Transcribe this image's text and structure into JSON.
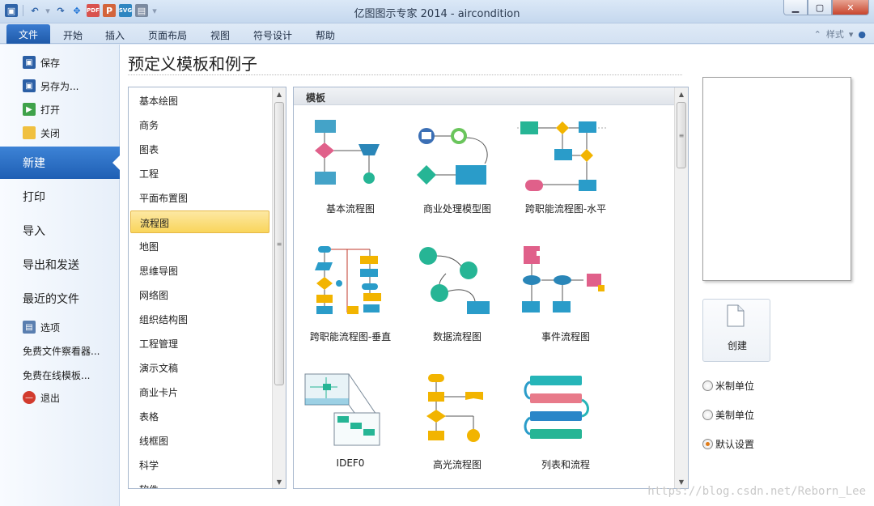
{
  "window": {
    "title": "亿图图示专家 2014 - aircondition",
    "controls": [
      "minimize-icon",
      "maximize-icon",
      "close-icon"
    ]
  },
  "quick_access": [
    "save-icon",
    "undo-icon",
    "redo-icon",
    "move-icon",
    "pdf-icon",
    "ppt-icon",
    "svg-icon",
    "print-icon"
  ],
  "ribbon": {
    "file_tab": "文件",
    "tabs": [
      "开始",
      "插入",
      "页面布局",
      "视图",
      "符号设计",
      "帮助"
    ],
    "right_text": "样式"
  },
  "backstage_nav": {
    "top_items": [
      {
        "label": "保存",
        "icon": "save-icon"
      },
      {
        "label": "另存为...",
        "icon": "save-as-icon"
      },
      {
        "label": "打开",
        "icon": "open-icon"
      },
      {
        "label": "关闭",
        "icon": "close-folder-icon"
      }
    ],
    "big_items": [
      "新建",
      "打印",
      "导入",
      "导出和发送",
      "最近的文件"
    ],
    "active": "新建",
    "bottom_items": [
      {
        "label": "选项",
        "icon": "options-icon"
      },
      {
        "label": "免费文件察看器...",
        "icon": ""
      },
      {
        "label": "免费在线模板...",
        "icon": ""
      },
      {
        "label": "退出",
        "icon": "exit-icon"
      }
    ]
  },
  "main": {
    "heading": "预定义模板和例子",
    "categories": [
      "基本绘图",
      "商务",
      "图表",
      "工程",
      "平面布置图",
      "流程图",
      "地图",
      "思维导图",
      "网络图",
      "组织结构图",
      "工程管理",
      "演示文稿",
      "商业卡片",
      "表格",
      "线框图",
      "科学",
      "软件"
    ],
    "selected_category": "流程图",
    "gallery": {
      "header": "模板",
      "templates": [
        {
          "label": "基本流程图"
        },
        {
          "label": "商业处理模型图"
        },
        {
          "label": "跨职能流程图-水平"
        },
        {
          "label": "跨职能流程图-垂直"
        },
        {
          "label": "数据流程图"
        },
        {
          "label": "事件流程图"
        },
        {
          "label": "IDEF0"
        },
        {
          "label": "高光流程图"
        },
        {
          "label": "列表和流程"
        }
      ]
    }
  },
  "right_panel": {
    "create_label": "创建",
    "units": [
      {
        "label": "米制单位",
        "checked": false
      },
      {
        "label": "美制单位",
        "checked": false
      },
      {
        "label": "默认设置",
        "checked": true
      }
    ]
  },
  "watermark": "https://blog.csdn.net/Reborn_Lee",
  "colors": {
    "accent_blue": "#1f5fb4",
    "selection_yellow": "#f9d55b",
    "shape_blue": "#44a3c8",
    "shape_pink": "#e0608a",
    "shape_yellow": "#f2b400",
    "shape_teal": "#26b595"
  }
}
